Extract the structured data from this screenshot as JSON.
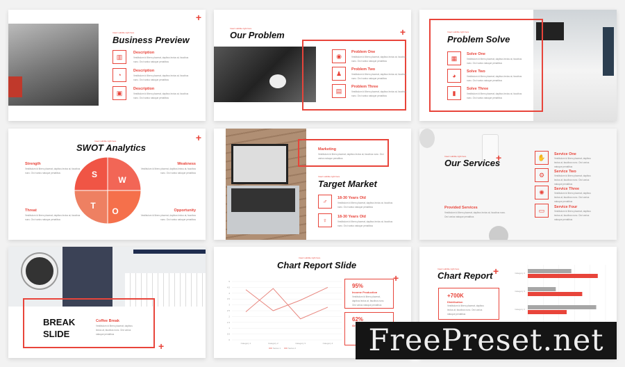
{
  "subtitle": "Insert subtitle right here",
  "lorem": "Vestibulum id libero placerat, dapibus lectus at, faucibus nunc. Orci varius natoque penatibus",
  "accent": "#e8443a",
  "slides": {
    "business": {
      "title": "Business Preview",
      "items": [
        {
          "label": "Description",
          "icon": "bar-chart-icon"
        },
        {
          "label": "Description",
          "icon": "pie-chart-icon"
        },
        {
          "label": "Description",
          "icon": "presentation-icon"
        }
      ]
    },
    "problem": {
      "title": "Our Problem",
      "items": [
        {
          "label": "Problem One",
          "icon": "money-icon"
        },
        {
          "label": "Problem Two",
          "icon": "user-icon"
        },
        {
          "label": "Problem Three",
          "icon": "briefcase-icon"
        }
      ]
    },
    "solve": {
      "title": "Problem Solve",
      "items": [
        {
          "label": "Solve One",
          "icon": "clipboard-icon"
        },
        {
          "label": "Solve Two",
          "icon": "pie-chart-icon"
        },
        {
          "label": "Solve Three",
          "icon": "document-icon"
        }
      ]
    },
    "swot": {
      "title": "SWOT Analytics",
      "letters": [
        "S",
        "W",
        "T",
        "O"
      ],
      "labels": [
        "Strength",
        "Weakness",
        "Threat",
        "Opportunity"
      ]
    },
    "target": {
      "title": "Target Market",
      "box_label": "Marketing",
      "items": [
        {
          "label": "18-30 Years Old",
          "icon": "male-icon"
        },
        {
          "label": "18-30 Years Old",
          "icon": "female-icon"
        }
      ]
    },
    "services": {
      "title": "Our Services",
      "provided": "Provided Services",
      "items": [
        {
          "label": "Service One",
          "icon": "handshake-icon"
        },
        {
          "label": "Service Two",
          "icon": "gears-icon"
        },
        {
          "label": "Service Three",
          "icon": "brain-icon"
        },
        {
          "label": "Service Four",
          "icon": "monitor-icon"
        }
      ]
    },
    "break": {
      "title1": "BREAK",
      "title2": "SLIDE",
      "label": "Coffee Break"
    },
    "chart_slide": {
      "title": "Chart Report Slide",
      "stats": [
        {
          "value": "95%",
          "label": "Income Production"
        },
        {
          "value": "62%",
          "label": "Growth"
        }
      ]
    },
    "chart_report": {
      "title": "Chart Report",
      "value": "+700K",
      "label": "Distribution"
    }
  },
  "watermark": "FreePreset.net",
  "chart_data": [
    {
      "type": "line",
      "categories": [
        "Category 1",
        "Category 2",
        "Category 3",
        "Category 4"
      ],
      "ylim": [
        0,
        5
      ],
      "yticks": [
        "5",
        "4.5",
        "4",
        "3.5",
        "3",
        "2.5",
        "2",
        "1.5",
        "1",
        "0.5",
        "0"
      ],
      "series": [
        {
          "name": "Series 1",
          "values": [
            4.3,
            2.5,
            3.4,
            4.5
          ]
        },
        {
          "name": "Series 2",
          "values": [
            2.4,
            4.4,
            1.8,
            2.8
          ]
        }
      ],
      "legend": "bottom",
      "colors": [
        "#e8877f",
        "#e8877f"
      ]
    },
    {
      "type": "bar",
      "orientation": "horizontal",
      "categories": [
        "Category 4",
        "Category 3",
        "Category 2",
        "Category 1"
      ],
      "xlim": [
        0,
        5
      ],
      "series": [
        {
          "values": [
            2.8,
            1.8,
            4.4,
            2.4
          ],
          "color": "#a6a6a6"
        },
        {
          "values": [
            4.5,
            3.5,
            2.5,
            null
          ],
          "color": "#e8443a"
        }
      ]
    }
  ]
}
